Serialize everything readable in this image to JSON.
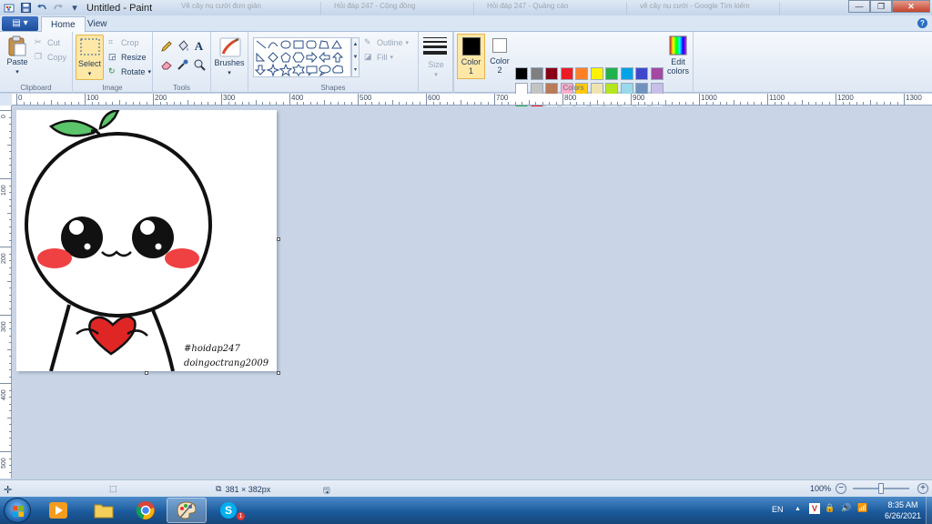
{
  "window": {
    "title": "Untitled - Paint",
    "qat_menu_glyph": "▾",
    "background_tabs": [
      "Vẽ cây nụ cười đơn giản",
      "Hỏi đáp 247 - Cộng đồng",
      "Hỏi đáp 247 - Quảng cáo",
      "vẽ cây nụ cười - Google Tìm kiếm"
    ]
  },
  "ribbon_tabs": {
    "file": "▤ ▾",
    "home": "Home",
    "view": "View"
  },
  "clipboard": {
    "paste": "Paste",
    "cut": "Cut",
    "copy": "Copy",
    "group_label": "Clipboard"
  },
  "image": {
    "select": "Select",
    "crop": "Crop",
    "resize": "Resize",
    "rotate": "Rotate",
    "group_label": "Image"
  },
  "tools": {
    "group_label": "Tools",
    "text_tool_glyph": "A"
  },
  "brushes": {
    "label": "Brushes"
  },
  "shapes": {
    "outline": "Outline",
    "fill": "Fill",
    "group_label": "Shapes"
  },
  "size": {
    "label": "Size"
  },
  "colors": {
    "color1_label": "Color",
    "color1_num": "1",
    "color2_label": "Color",
    "color2_num": "2",
    "edit_colors_line1": "Edit",
    "edit_colors_line2": "colors",
    "group_label": "Colors",
    "palette_row1": [
      "#000000",
      "#7f7f7f",
      "#880015",
      "#ed1c24",
      "#ff7f27",
      "#fff200",
      "#22b14c",
      "#00a2e8",
      "#3f48cc",
      "#a349a4"
    ],
    "palette_row2": [
      "#ffffff",
      "#c3c3c3",
      "#b97a57",
      "#ffaec9",
      "#ffc90e",
      "#efe4b0",
      "#b5e61d",
      "#99d9ea",
      "#7092be",
      "#c8bfe7"
    ],
    "palette_row3": [
      "#22b14c",
      "#ed1c24"
    ]
  },
  "ruler": {
    "top_labels": [
      "0",
      "100",
      "200",
      "300",
      "400",
      "500",
      "600",
      "700",
      "800",
      "900",
      "1000",
      "1100",
      "1200",
      "1300"
    ],
    "left_labels": [
      "0",
      "100",
      "200",
      "300",
      "400",
      "500"
    ]
  },
  "canvas": {
    "watermark_line1": "#hoidap247",
    "watermark_line2": "doingoctrang2009"
  },
  "status": {
    "dimensions": "381 × 382px",
    "zoom": "100%",
    "zoom_out": "−",
    "zoom_in": "+"
  },
  "taskbar": {
    "language": "EN",
    "time": "8:35 AM",
    "date": "6/26/2021",
    "skype_badge": "1",
    "tray_glyphs": [
      "▲",
      "V",
      "🔒",
      "🔊",
      "📶"
    ]
  }
}
